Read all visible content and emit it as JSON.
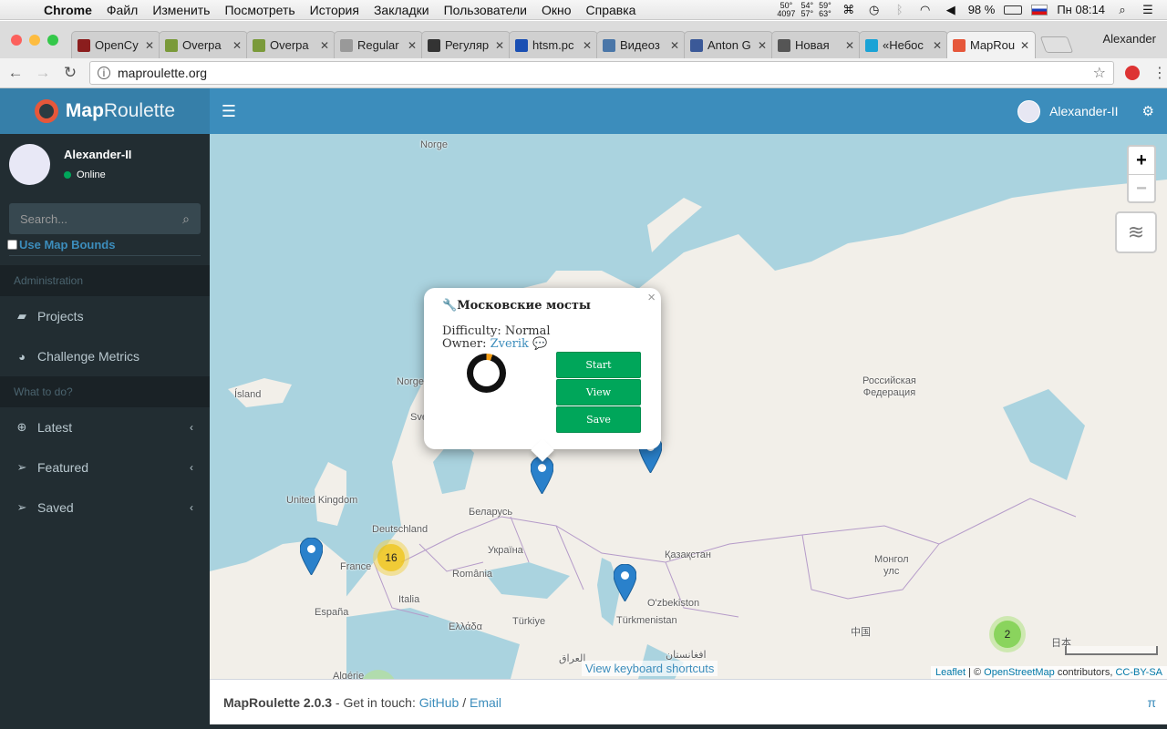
{
  "os_menubar": {
    "app": "Chrome",
    "menus": [
      "Файл",
      "Изменить",
      "Посмотреть",
      "История",
      "Закладки",
      "Пользователи",
      "Окно",
      "Справка"
    ],
    "temps": [
      [
        "50°",
        "4097"
      ],
      [
        "54°",
        "57°"
      ],
      [
        "59°",
        "63°"
      ]
    ],
    "battery": "98 %",
    "clock": "Пн 08:14"
  },
  "browser": {
    "profile": "Alexander",
    "tabs": [
      {
        "title": "OpenCy",
        "color": "#8b1d1d"
      },
      {
        "title": "Overpa",
        "color": "#7a9a3a"
      },
      {
        "title": "Overpa",
        "color": "#7a9a3a"
      },
      {
        "title": "Regular",
        "color": "#999999"
      },
      {
        "title": "Регуляр",
        "color": "#333333"
      },
      {
        "title": "htsm.pc",
        "color": "#1a4fb3"
      },
      {
        "title": "Видеоз",
        "color": "#4a76a8"
      },
      {
        "title": "Anton G",
        "color": "#3b5998"
      },
      {
        "title": "Новая",
        "color": "#555555"
      },
      {
        "title": "«Небос",
        "color": "#1aa3d6"
      },
      {
        "title": "MapRou",
        "color": "#e6573a",
        "active": true
      }
    ],
    "url": "maproulette.org"
  },
  "app": {
    "logo_bold": "Map",
    "logo_light": "Roulette",
    "user": "Alexander-II"
  },
  "sidebar": {
    "username": "Alexander-II",
    "status": "Online",
    "search_placeholder": "Search...",
    "use_map_bounds": "Use Map Bounds",
    "section_admin": "Administration",
    "projects": "Projects",
    "metrics": "Challenge Metrics",
    "section_todo": "What to do?",
    "latest": "Latest",
    "featured": "Featured",
    "saved": "Saved"
  },
  "map": {
    "places": {
      "norge_top": "Norge",
      "norge": "Norge",
      "island": "Ísland",
      "uk": "United Kingdom",
      "deutschland": "Deutschland",
      "france": "France",
      "espana": "España",
      "italia": "Italia",
      "belarus": "Беларусь",
      "ukraina": "Україна",
      "romania": "România",
      "ellada": "Ελλάδα",
      "turkiye": "Türkiye",
      "kazakhstan": "Қазақстан",
      "uzbekiston": "O'zbekiston",
      "turkmenistan": "Türkmenistan",
      "mongol": "Монгол\nулс",
      "rf": "Российская\nФедерация",
      "china": "中国",
      "japan": "日本",
      "algerie": "Algérie",
      "iraq": "العراق",
      "afghanistan": "افغانستان",
      "sve": "Sve"
    },
    "clusters": {
      "europe": "16",
      "east_asia": "2"
    },
    "popup": {
      "title": "Московские мосты",
      "difficulty": "Difficulty: Normal",
      "owner_label": "Owner:",
      "owner": "Zverik",
      "progress": 0.05,
      "start": "Start",
      "view": "View",
      "save": "Save"
    },
    "zoom_in": "+",
    "zoom_out": "−",
    "keyboard_shortcuts": "View keyboard shortcuts",
    "attribution": {
      "leaflet": "Leaflet",
      "sep": " | © ",
      "osm": "OpenStreetMap",
      "contrib": " contributors, ",
      "license": "CC-BY-SA"
    }
  },
  "footer": {
    "version": "MapRoulette 2.0.3",
    "touch": " - Get in touch: ",
    "github": "GitHub",
    "slash": " / ",
    "email": "Email",
    "pi": "π"
  },
  "colors": {
    "header": "#3c8dbc",
    "logo_bg": "#367fa9",
    "sidebar": "#222d32",
    "button_green": "#00a65a",
    "marker_blue": "#2a81cb"
  }
}
